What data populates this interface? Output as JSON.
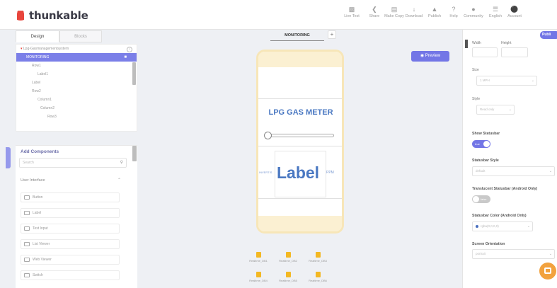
{
  "app": {
    "brand": "thunkable",
    "brand_color": "#e8453c",
    "accent": "#7376e6"
  },
  "toolbar": [
    {
      "label": "Live Test",
      "icon": "phone-icon"
    },
    {
      "label": "Share",
      "icon": "share-icon"
    },
    {
      "label": "Make Copy",
      "icon": "copy-icon"
    },
    {
      "label": "Download",
      "icon": "download-icon"
    },
    {
      "label": "Publish",
      "icon": "publish-icon"
    },
    {
      "label": "Help",
      "icon": "help-icon"
    },
    {
      "label": "Community",
      "icon": "community-icon"
    },
    {
      "label": "English",
      "icon": "language-icon"
    },
    {
      "label": "Account",
      "icon": "account-icon"
    }
  ],
  "publish_label": "Publi",
  "tabs": {
    "design": "Design",
    "blocks": "Blocks"
  },
  "screen": {
    "current": "MONITORING",
    "add": "+"
  },
  "tree": {
    "project": "Lpg-Gasmanagementsystem",
    "items": [
      {
        "label": "MONITORING",
        "selected": true
      },
      {
        "label": "Row1"
      },
      {
        "label": "Label1"
      },
      {
        "label": "Label"
      },
      {
        "label": "Row2"
      },
      {
        "label": "Column1"
      },
      {
        "label": "Column2"
      },
      {
        "label": "Row3"
      }
    ]
  },
  "add_components": {
    "title": "Add Components",
    "search_placeholder": "Search",
    "category": "User Interface",
    "items": [
      {
        "label": "Button"
      },
      {
        "label": "Label"
      },
      {
        "label": "Text Input"
      },
      {
        "label": "List Viewer"
      },
      {
        "label": "Web Viewer"
      },
      {
        "label": "Switch"
      }
    ]
  },
  "canvas": {
    "preview_label": "Preview",
    "meter_title": "LPG GAS METER",
    "left_small": "INVERTIS",
    "big_label": "Label",
    "right_small": "PPM",
    "nonvisible": [
      "Realtime_DB1",
      "Realtime_DB2",
      "Realtime_DB3",
      "Realtime_DB4",
      "Realtime_DB5",
      "Realtime_DB6"
    ]
  },
  "props": {
    "width_label": "Width",
    "height_label": "Height",
    "size_label": "Size",
    "size_value": "1 MPH",
    "style_label": "Style",
    "style_value": "Read only",
    "show_statusbar_label": "Show Statusbar",
    "show_statusbar_toggle": "true",
    "statusbar_style_label": "Statusbar Style",
    "statusbar_style_value": "default",
    "translucent_label": "Translucent Statusbar (Android Only)",
    "translucent_toggle": "false",
    "statusbar_color_label": "Statusbar Color (Android Only)",
    "statusbar_color_value": "rgba(0,0,0,0)",
    "orientation_label": "Screen Orientation",
    "orientation_value": "portrait"
  }
}
